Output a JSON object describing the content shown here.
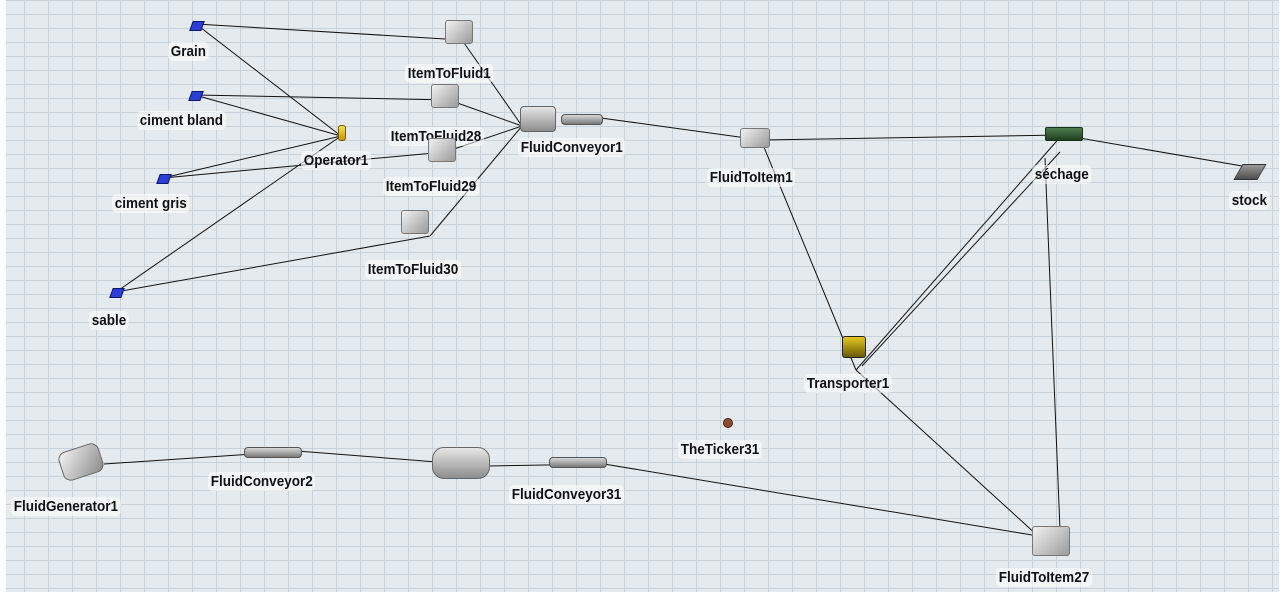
{
  "model": {
    "nodes": [
      {
        "id": "grain",
        "label": "Grain",
        "icon": "source-icon"
      },
      {
        "id": "ciment_bland",
        "label": "ciment bland",
        "icon": "source-icon"
      },
      {
        "id": "ciment_gris",
        "label": "ciment gris",
        "icon": "source-icon"
      },
      {
        "id": "sable",
        "label": "sable",
        "icon": "source-icon"
      },
      {
        "id": "operator1",
        "label": "Operator1",
        "icon": "operator-icon"
      },
      {
        "id": "itemtofluid1",
        "label": "ItemToFluid1",
        "icon": "item-to-fluid-icon"
      },
      {
        "id": "itemtofluid28",
        "label": "ItemToFluid28",
        "icon": "item-to-fluid-icon"
      },
      {
        "id": "itemtofluid29",
        "label": "ItemToFluid29",
        "icon": "item-to-fluid-icon"
      },
      {
        "id": "itemtofluid30",
        "label": "ItemToFluid30",
        "icon": "item-to-fluid-icon"
      },
      {
        "id": "fluidconveyor1",
        "label": "FluidConveyor1",
        "icon": "fluid-conveyor-icon"
      },
      {
        "id": "fluidtoitem1",
        "label": "FluidToItem1",
        "icon": "fluid-to-item-icon"
      },
      {
        "id": "sechage",
        "label": "séchage",
        "icon": "processor-icon"
      },
      {
        "id": "stock",
        "label": "stock",
        "icon": "sink-icon"
      },
      {
        "id": "transporter1",
        "label": "Transporter1",
        "icon": "forklift-icon"
      },
      {
        "id": "theticker31",
        "label": "TheTicker31",
        "icon": "ticker-icon"
      },
      {
        "id": "fluidgenerator1",
        "label": "FluidGenerator1",
        "icon": "fluid-generator-icon"
      },
      {
        "id": "fluidconveyor2",
        "label": "FluidConveyor2",
        "icon": "fluid-conveyor-icon"
      },
      {
        "id": "tank",
        "label": "",
        "icon": "fluid-tank-icon"
      },
      {
        "id": "fluidconveyor31",
        "label": "FluidConveyor31",
        "icon": "fluid-conveyor-icon"
      },
      {
        "id": "fluidtoitem27",
        "label": "FluidToItem27",
        "icon": "fluid-to-item-icon"
      }
    ],
    "connections": [
      [
        "grain",
        "itemtofluid1"
      ],
      [
        "grain",
        "operator1"
      ],
      [
        "ciment_bland",
        "itemtofluid28"
      ],
      [
        "ciment_bland",
        "operator1"
      ],
      [
        "ciment_gris",
        "itemtofluid29"
      ],
      [
        "ciment_gris",
        "operator1"
      ],
      [
        "sable",
        "itemtofluid30"
      ],
      [
        "sable",
        "operator1"
      ],
      [
        "itemtofluid1",
        "fluidconveyor1"
      ],
      [
        "itemtofluid28",
        "fluidconveyor1"
      ],
      [
        "itemtofluid29",
        "fluidconveyor1"
      ],
      [
        "itemtofluid30",
        "fluidconveyor1"
      ],
      [
        "fluidconveyor1",
        "fluidtoitem1"
      ],
      [
        "fluidtoitem1",
        "sechage"
      ],
      [
        "sechage",
        "stock"
      ],
      [
        "fluidtoitem1",
        "transporter1"
      ],
      [
        "transporter1",
        "sechage"
      ],
      [
        "transporter1",
        "fluidtoitem27"
      ],
      [
        "sechage",
        "fluidtoitem27"
      ],
      [
        "fluidgenerator1",
        "fluidconveyor2"
      ],
      [
        "fluidconveyor2",
        "tank"
      ],
      [
        "tank",
        "fluidconveyor31"
      ],
      [
        "fluidconveyor31",
        "fluidtoitem27"
      ]
    ]
  }
}
